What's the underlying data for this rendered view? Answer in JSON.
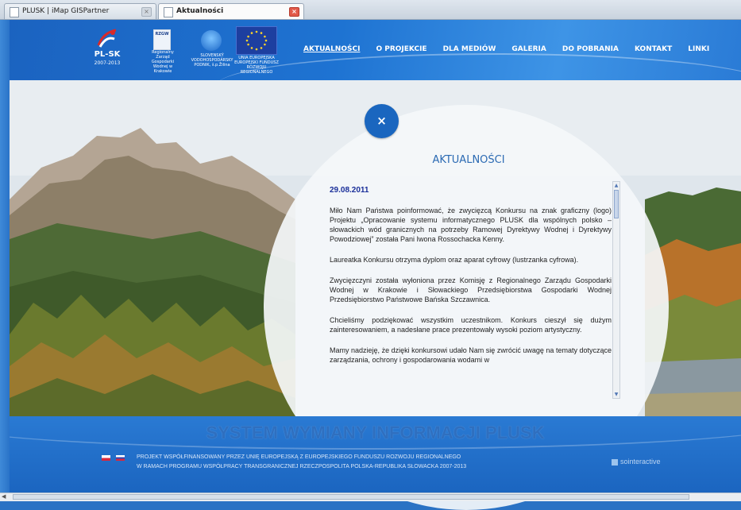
{
  "browser": {
    "tabs": [
      {
        "label": "PLUSK | iMap GISPartner",
        "active": false
      },
      {
        "label": "Aktualności",
        "active": true
      }
    ],
    "close_glyph": "×"
  },
  "header": {
    "logos": {
      "plsk_label": "PL-SK",
      "plsk_years": "2007-2013",
      "rzgw_label": "RZGW",
      "rzgw_name": "Regionalny Zarząd Gospodarki Wodnej w Krakowie",
      "svp_name": "SLOVENSKÝ VODOHOSPODÁRSKY PODNIK, š.p.Žilina",
      "eu_name": "UNIA EUROPEJSKA",
      "eu_fund": "EUROPEJSKI FUNDUSZ ROZWOJU REGIONALNEGO"
    },
    "nav": [
      {
        "label": "AKTUALNOŚCI",
        "active": true
      },
      {
        "label": "O PROJEKCIE",
        "active": false
      },
      {
        "label": "DLA MEDIÓW",
        "active": false
      },
      {
        "label": "GALERIA",
        "active": false
      },
      {
        "label": "DO POBRANIA",
        "active": false
      },
      {
        "label": "KONTAKT",
        "active": false
      },
      {
        "label": "LINKI",
        "active": false
      }
    ]
  },
  "panel": {
    "close_icon": "×",
    "title": "AKTUALNOŚCI",
    "date": "29.08.2011",
    "paragraphs": [
      "Miło Nam Państwa poinformować, że zwycięzcą Konkursu na znak graficzny (logo) Projektu „Opracowanie systemu informatycznego PLUSK dla wspólnych polsko – słowackich wód granicznych na potrzeby Ramowej Dyrektywy Wodnej i Dyrektywy Powodziowej” została Pani Iwona Rossochacka Kenny.",
      "Laureatka Konkursu otrzyma dyplom oraz aparat cyfrowy (lustrzanka cyfrowa).",
      "Zwycięzczyni została wyłoniona przez Komisję z Regionalnego Zarządu Gospodarki Wodnej w Krakowie i Słowackiego Przedsiębiorstwa Gospodarki Wodnej Przedsiębiorstwo Państwowe Bańska Szczawnica.",
      "Chcieliśmy podziękować wszystkim uczestnikom. Konkurs cieszył się dużym zainteresowaniem, a nadesłane prace prezentowały wysoki poziom artystyczny.",
      "Mamy nadzieję, że dzięki konkursowi udało Nam się zwrócić uwagę na tematy dotyczące zarządzania, ochrony i gospodarowania wodami w"
    ]
  },
  "footer": {
    "title": "SYSTEM WYMIANY INFORMACJI PLUSK",
    "line1": "PROJEKT WSPÓŁFINANSOWANY PRZEZ UNIĘ EUROPEJSKĄ Z EUROPEJSKIEGO FUNDUSZU ROZWOJU REGIONALNEGO",
    "line2": "W RAMACH PROGRAMU WSPÓŁPRACY TRANSGRANICZNEJ RZECZPOSPOLITA POLSKA-REPUBLIKA SŁOWACKA 2007-2013",
    "brand": "sointeractive"
  },
  "colors": {
    "accent_blue": "#1a66bf",
    "title_blue": "#2b6ab3",
    "date_blue": "#1a2f9a"
  }
}
